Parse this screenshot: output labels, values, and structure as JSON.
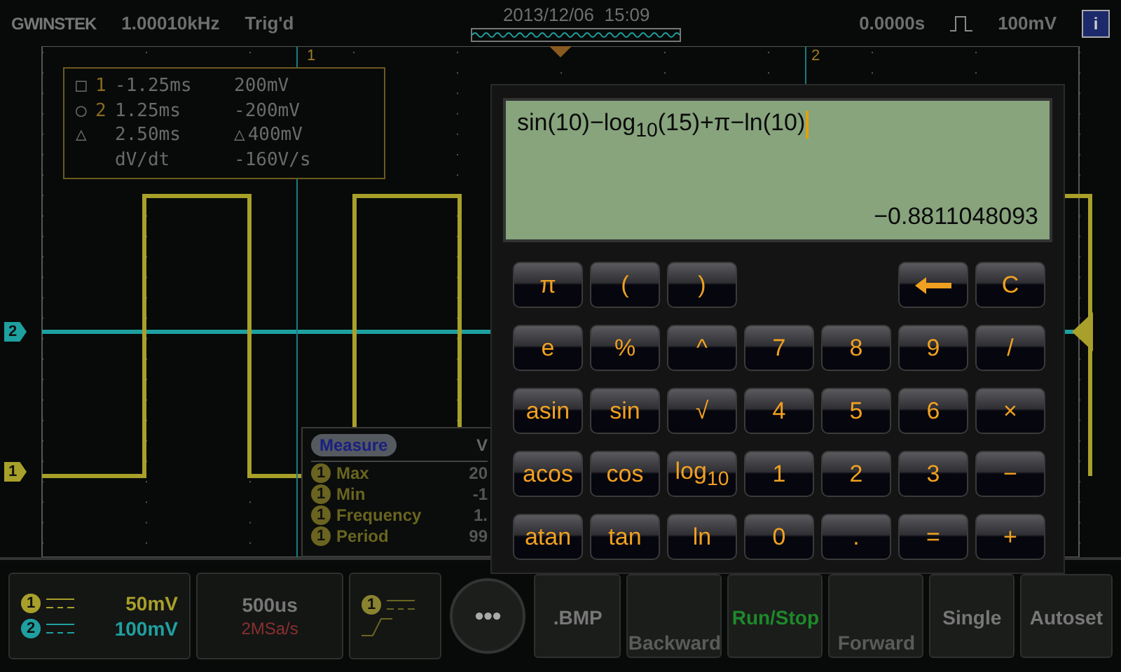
{
  "header": {
    "brand": "GWINSTEK",
    "frequency": "1.00010kHz",
    "trigger_status": "Trig'd",
    "datetime": "2013/12/06  15:09",
    "time_offset": "0.0000s",
    "trigger_level": "100mV",
    "info_label": "i"
  },
  "graticule": {
    "cursor_labels": [
      "1",
      "2"
    ],
    "channel_markers": [
      {
        "label": "2",
        "color": "#1fa0a0"
      },
      {
        "label": "1",
        "color": "#a8a02a"
      }
    ]
  },
  "cursor_readout": [
    {
      "symbol": "□",
      "channel": "1",
      "time": "-1.25ms",
      "volts": "200mV"
    },
    {
      "symbol": "○",
      "channel": "2",
      "time": "1.25ms",
      "volts": "-200mV"
    },
    {
      "symbol": "△",
      "time": "2.50ms",
      "volts_symbol": "△",
      "volts": "400mV"
    },
    {
      "time": "dV/dt",
      "volts": "-160V/s"
    }
  ],
  "measure": {
    "title": "Measure",
    "column_2": "V",
    "rows": [
      {
        "source": "1",
        "name": "Max",
        "value": "20"
      },
      {
        "source": "1",
        "name": "Min",
        "value": "-1"
      },
      {
        "source": "1",
        "name": "Frequency",
        "value": "1."
      },
      {
        "source": "1",
        "name": "Period",
        "value": "99"
      }
    ]
  },
  "calculator": {
    "expression": "sin(10)−log$_{10}$(15)+π−ln(10)",
    "cursor": true,
    "result": "−0.8811048093",
    "keys": [
      [
        {
          "kind": "key",
          "label": "π"
        },
        {
          "kind": "key",
          "label": "("
        },
        {
          "kind": "key",
          "label": ")"
        },
        {
          "kind": "spacer"
        },
        {
          "kind": "spacer"
        },
        {
          "kind": "backspace"
        },
        {
          "kind": "key",
          "label": "C"
        }
      ],
      [
        {
          "kind": "key",
          "label": "e"
        },
        {
          "kind": "key",
          "label": "%"
        },
        {
          "kind": "key",
          "label": "^"
        },
        {
          "kind": "key",
          "label": "7"
        },
        {
          "kind": "key",
          "label": "8"
        },
        {
          "kind": "key",
          "label": "9"
        },
        {
          "kind": "key",
          "label": "/"
        }
      ],
      [
        {
          "kind": "key",
          "label": "asin"
        },
        {
          "kind": "key",
          "label": "sin"
        },
        {
          "kind": "key",
          "label": "√"
        },
        {
          "kind": "key",
          "label": "4"
        },
        {
          "kind": "key",
          "label": "5"
        },
        {
          "kind": "key",
          "label": "6"
        },
        {
          "kind": "key",
          "label": "×"
        }
      ],
      [
        {
          "kind": "key",
          "label": "acos"
        },
        {
          "kind": "key",
          "label": "cos"
        },
        {
          "kind": "key",
          "label": "log$_{10}$"
        },
        {
          "kind": "key",
          "label": "1"
        },
        {
          "kind": "key",
          "label": "2"
        },
        {
          "kind": "key",
          "label": "3"
        },
        {
          "kind": "key",
          "label": "−"
        }
      ],
      [
        {
          "kind": "key",
          "label": "atan"
        },
        {
          "kind": "key",
          "label": "tan"
        },
        {
          "kind": "key",
          "label": "ln"
        },
        {
          "kind": "key",
          "label": "0"
        },
        {
          "kind": "key",
          "label": "."
        },
        {
          "kind": "key",
          "label": "="
        },
        {
          "kind": "key",
          "label": "+"
        }
      ]
    ]
  },
  "bottom_bar": {
    "channels": [
      {
        "number": "1",
        "scale": "50mV",
        "color": "#a8a02a"
      },
      {
        "number": "2",
        "scale": "100mV",
        "color": "#1fa0a0"
      }
    ],
    "more_label": "•••",
    "timebase": "500us",
    "sample_rate": "2MSa/s",
    "trigger_source": "1",
    "buttons": [
      {
        "label": ".BMP",
        "kind": "bmp",
        "disabled": false
      },
      {
        "label": "Backward",
        "kind": "nav",
        "disabled": true
      },
      {
        "label": "Run/Stop",
        "kind": "run",
        "disabled": false
      },
      {
        "label": "Forward",
        "kind": "nav",
        "disabled": true
      },
      {
        "label": "Single",
        "kind": "plain",
        "disabled": false
      },
      {
        "label": "Autoset",
        "kind": "plain",
        "disabled": false
      }
    ]
  }
}
